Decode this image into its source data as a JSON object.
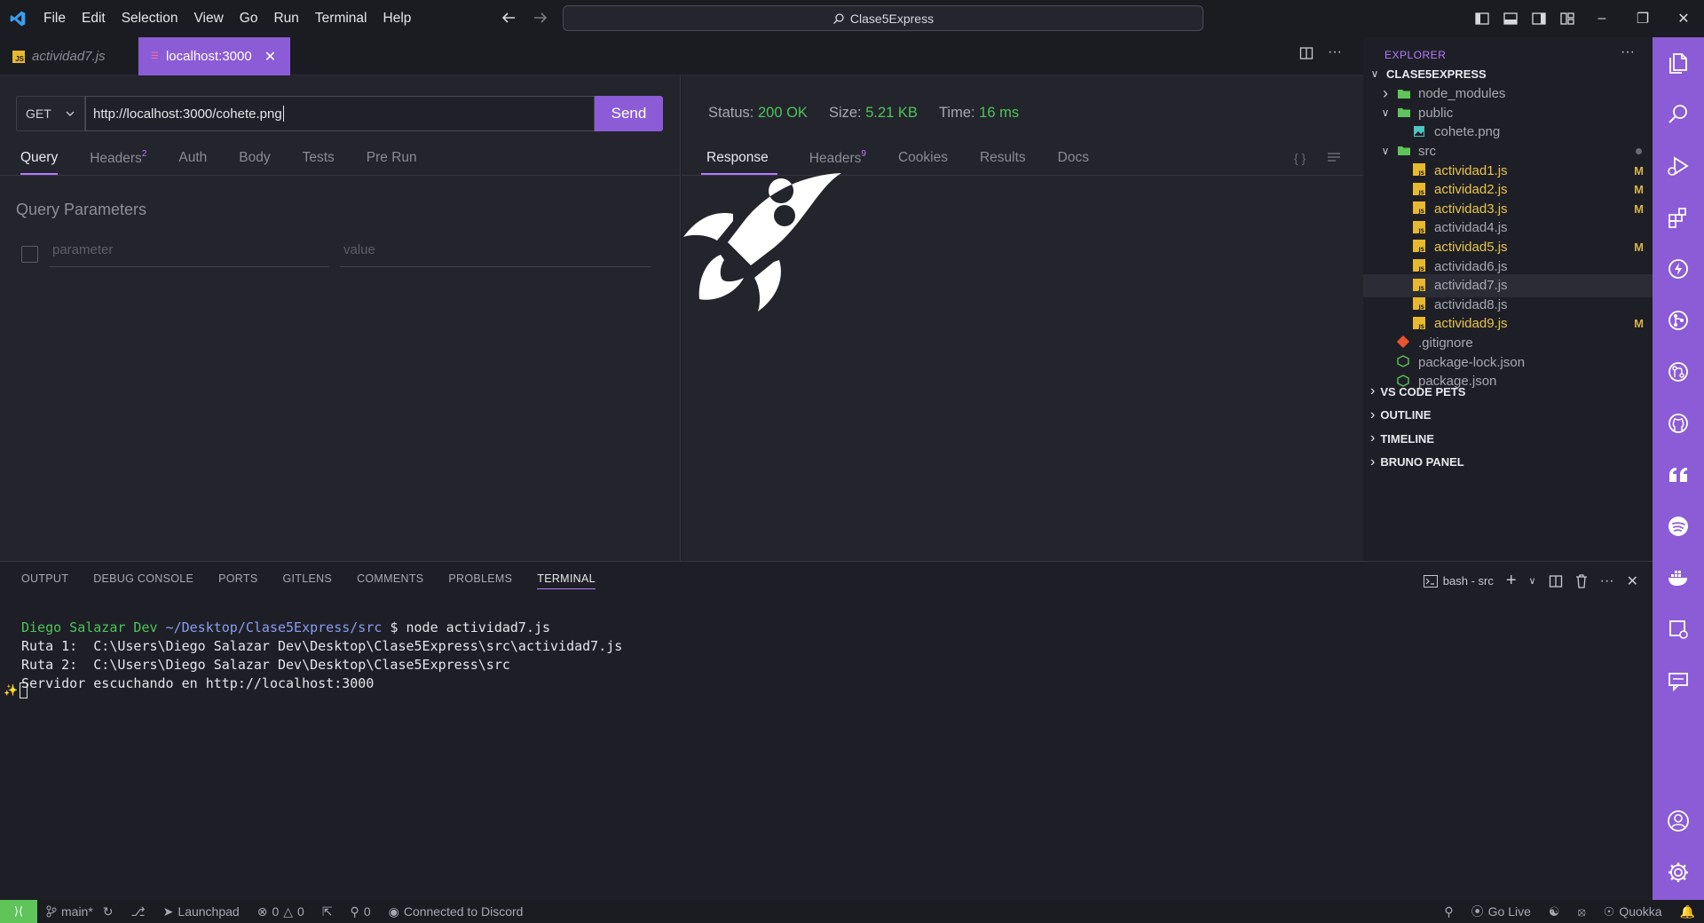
{
  "menu": [
    "File",
    "Edit",
    "Selection",
    "View",
    "Go",
    "Run",
    "Terminal",
    "Help"
  ],
  "command_center": {
    "label": "Clase5Express"
  },
  "tabs": [
    {
      "label": "actividad7.js",
      "icon": "js-file-icon",
      "active": false
    },
    {
      "label": "localhost:3000",
      "icon": "bruno-icon",
      "active": true
    }
  ],
  "request": {
    "method": "GET",
    "url": "http://localhost:3000/cohete.png",
    "send_label": "Send",
    "tabs": [
      {
        "label": "Query",
        "active": true
      },
      {
        "label": "Headers",
        "count": "2"
      },
      {
        "label": "Auth"
      },
      {
        "label": "Body"
      },
      {
        "label": "Tests"
      },
      {
        "label": "Pre Run"
      }
    ],
    "query_title": "Query Parameters",
    "param_placeholder": "parameter",
    "value_placeholder": "value"
  },
  "response": {
    "status_label": "Status:",
    "status_value": "200 OK",
    "size_label": "Size:",
    "size_value": "5.21 KB",
    "time_label": "Time:",
    "time_value": "16 ms",
    "tabs": [
      {
        "label": "Response",
        "active": true
      },
      {
        "label": "Headers",
        "count": "9"
      },
      {
        "label": "Cookies"
      },
      {
        "label": "Results"
      },
      {
        "label": "Docs"
      }
    ],
    "image_icon": "rocket-icon"
  },
  "explorer": {
    "title": "EXPLORER",
    "root": "CLASE5EXPRESS",
    "items": [
      {
        "name": "node_modules",
        "type": "folder",
        "depth": 1,
        "expanded": false
      },
      {
        "name": "public",
        "type": "folder",
        "depth": 1,
        "expanded": true
      },
      {
        "name": "cohete.png",
        "type": "image",
        "depth": 2
      },
      {
        "name": "src",
        "type": "folder",
        "depth": 1,
        "expanded": true
      },
      {
        "name": "actividad1.js",
        "type": "js",
        "depth": 2,
        "mod": "M"
      },
      {
        "name": "actividad2.js",
        "type": "js",
        "depth": 2,
        "mod": "M"
      },
      {
        "name": "actividad3.js",
        "type": "js",
        "depth": 2,
        "mod": "M"
      },
      {
        "name": "actividad4.js",
        "type": "js",
        "depth": 2
      },
      {
        "name": "actividad5.js",
        "type": "js",
        "depth": 2,
        "mod": "M"
      },
      {
        "name": "actividad6.js",
        "type": "js",
        "depth": 2
      },
      {
        "name": "actividad7.js",
        "type": "js",
        "depth": 2,
        "selected": true
      },
      {
        "name": "actividad8.js",
        "type": "js",
        "depth": 2
      },
      {
        "name": "actividad9.js",
        "type": "js",
        "depth": 2,
        "mod": "M"
      },
      {
        "name": ".gitignore",
        "type": "git",
        "depth": 1
      },
      {
        "name": "package-lock.json",
        "type": "node",
        "depth": 1
      },
      {
        "name": "package.json",
        "type": "node",
        "depth": 1
      }
    ],
    "sections": [
      "VS CODE PETS",
      "OUTLINE",
      "TIMELINE",
      "BRUNO PANEL"
    ]
  },
  "panel": {
    "tabs": [
      "OUTPUT",
      "DEBUG CONSOLE",
      "PORTS",
      "GITLENS",
      "COMMENTS",
      "PROBLEMS",
      "TERMINAL"
    ],
    "active_tab": "TERMINAL",
    "terminal_name": "bash - src",
    "prompt_user": "Diego Salazar Dev",
    "prompt_path": "~/Desktop/Clase5Express/src",
    "prompt_cmd": "$ node actividad7.js",
    "output_lines": [
      "Ruta 1:  C:\\Users\\Diego Salazar Dev\\Desktop\\Clase5Express\\src\\actividad7.js",
      "Ruta 2:  C:\\Users\\Diego Salazar Dev\\Desktop\\Clase5Express\\src",
      "Servidor escuchando en http://localhost:3000"
    ]
  },
  "statusbar": {
    "branch": "main*",
    "launchpad": "Launchpad",
    "errors": "0",
    "warnings": "0",
    "ports": "0",
    "discord": "Connected to Discord",
    "golive": "Go Live",
    "quokka": "Quokka"
  },
  "colors": {
    "accent": "#8b5cd6",
    "status_ok": "#4ec45a",
    "modified": "#e8c44a",
    "background": "#23242c"
  }
}
